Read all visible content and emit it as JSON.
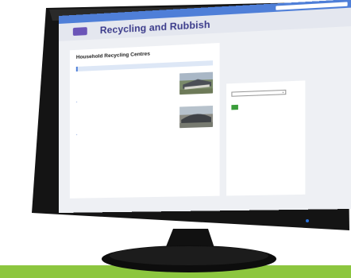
{
  "header": {
    "logo_text": "",
    "search_label": "",
    "search_placeholder": ""
  },
  "banner": {
    "menu_label": "",
    "site_title": "Recycling and Rubbish"
  },
  "breadcrumbs": {
    "home": "",
    "items": [
      "",
      ""
    ]
  },
  "main": {
    "heading": "Household Recycling Centres",
    "subtitle": "",
    "notice_line1": "",
    "notice_line2": "",
    "centres": [
      {
        "name": "",
        "address": [
          "",
          "",
          "",
          "",
          ""
        ],
        "link_text": ""
      },
      {
        "name": "",
        "address": [
          "",
          "",
          "",
          ""
        ],
        "link_text": ""
      },
      {
        "name": "",
        "address": [],
        "link_text": ""
      }
    ]
  },
  "sidebar": {
    "select_label": "",
    "select_value": "",
    "go_label": "",
    "related_title": "",
    "related_links": [
      "",
      "",
      ""
    ]
  },
  "colors": {
    "header_blue": "#4f7fd8",
    "menu_purple": "#6b55b8",
    "title_navy": "#3a3a8a",
    "link_blue": "#2b59c3",
    "go_green": "#3a9d3a",
    "floor_green": "#8cc63f"
  }
}
